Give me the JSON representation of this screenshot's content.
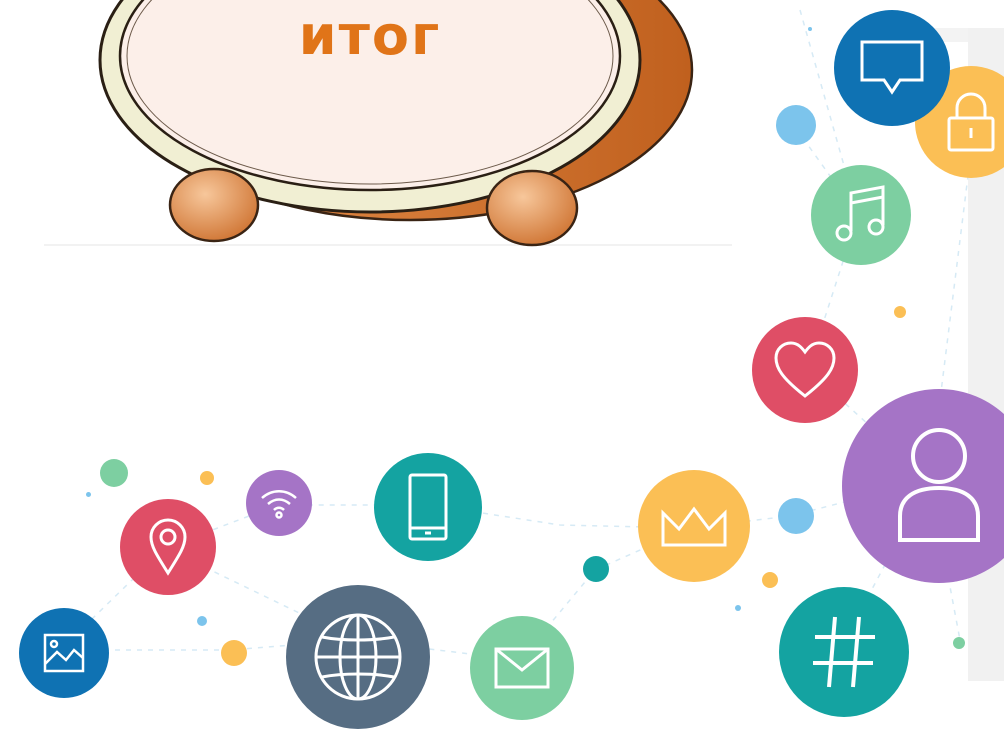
{
  "title": "итог",
  "colors": {
    "accent_orange": "#e07418",
    "clock_face": "#fcefe9",
    "clock_rim": "#f1efd3",
    "clock_body": "#d9762e",
    "blue": "#0f72b3",
    "green": "#7dcfa1",
    "teal": "#14a3a1",
    "red": "#df4e66",
    "purple": "#a574c6",
    "yellow": "#fbbf55",
    "slate": "#566d83",
    "light_blue": "#7cc4ec"
  },
  "icons": [
    "chat-bubble-icon",
    "lock-icon",
    "music-note-icon",
    "heart-icon",
    "user-icon",
    "crown-icon",
    "hashtag-icon",
    "smartphone-icon",
    "wifi-icon",
    "location-pin-icon",
    "image-icon",
    "globe-icon",
    "mail-icon"
  ]
}
